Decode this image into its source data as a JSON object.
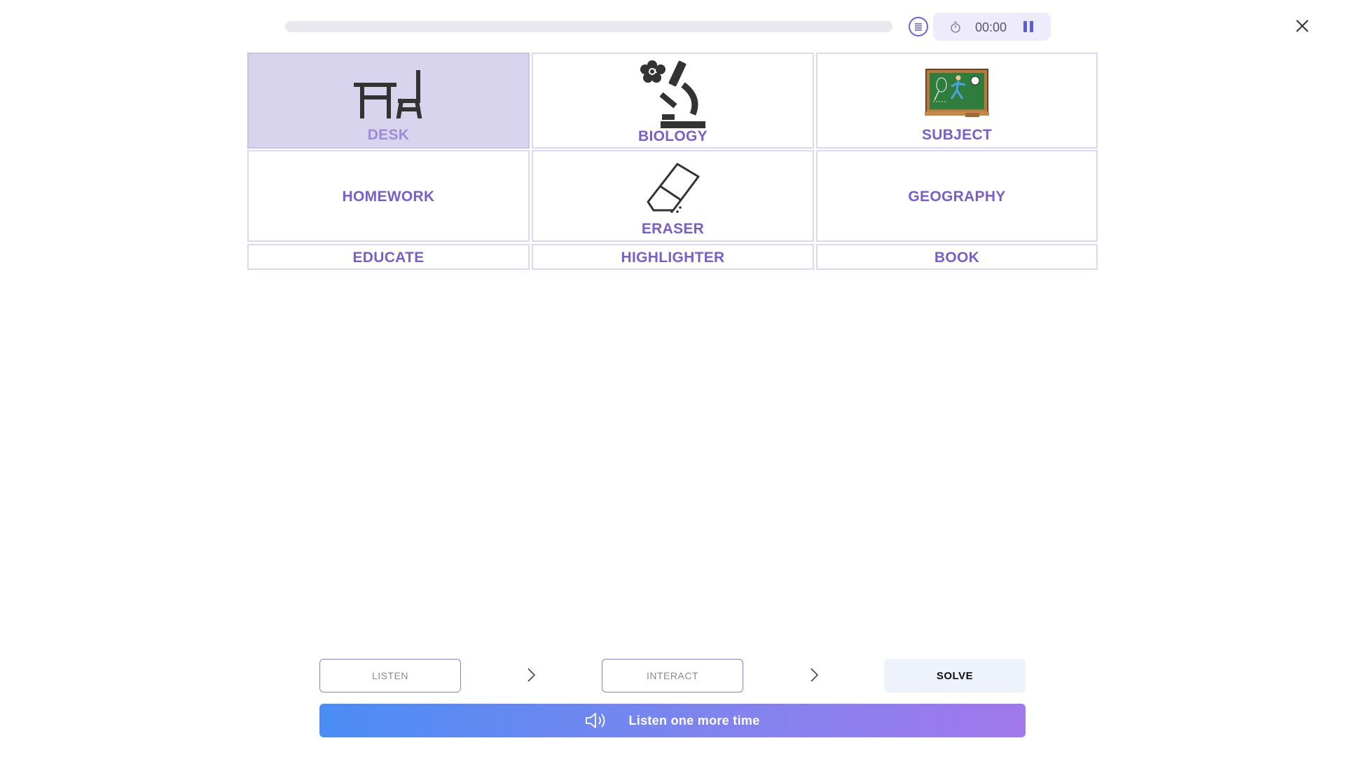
{
  "header": {
    "progress": 0,
    "timer": "00:00"
  },
  "tiles": [
    {
      "label": "DESK",
      "icon": "desk-chair-icon",
      "selected": true
    },
    {
      "label": "BIOLOGY",
      "icon": "microscope-icon",
      "selected": false
    },
    {
      "label": "SUBJECT",
      "icon": "chalkboard-sports-icon",
      "selected": false
    },
    {
      "label": "HOMEWORK",
      "icon": "",
      "selected": false
    },
    {
      "label": "ERASER",
      "icon": "eraser-icon",
      "selected": false
    },
    {
      "label": "GEOGRAPHY",
      "icon": "",
      "selected": false
    },
    {
      "label": "EDUCATE",
      "icon": "",
      "selected": false
    },
    {
      "label": "HIGHLIGHTER",
      "icon": "",
      "selected": false
    },
    {
      "label": "BOOK",
      "icon": "",
      "selected": false
    }
  ],
  "steps": [
    {
      "label": "LISTEN",
      "active": false
    },
    {
      "label": "INTERACT",
      "active": false
    },
    {
      "label": "SOLVE",
      "active": true
    }
  ],
  "listen_button": {
    "label": "Listen one more time"
  },
  "colors": {
    "accent": "#7a5fc8",
    "selected_tile": "#d9d4ee",
    "gradient_start": "#4a8df5",
    "gradient_end": "#a078ec"
  }
}
